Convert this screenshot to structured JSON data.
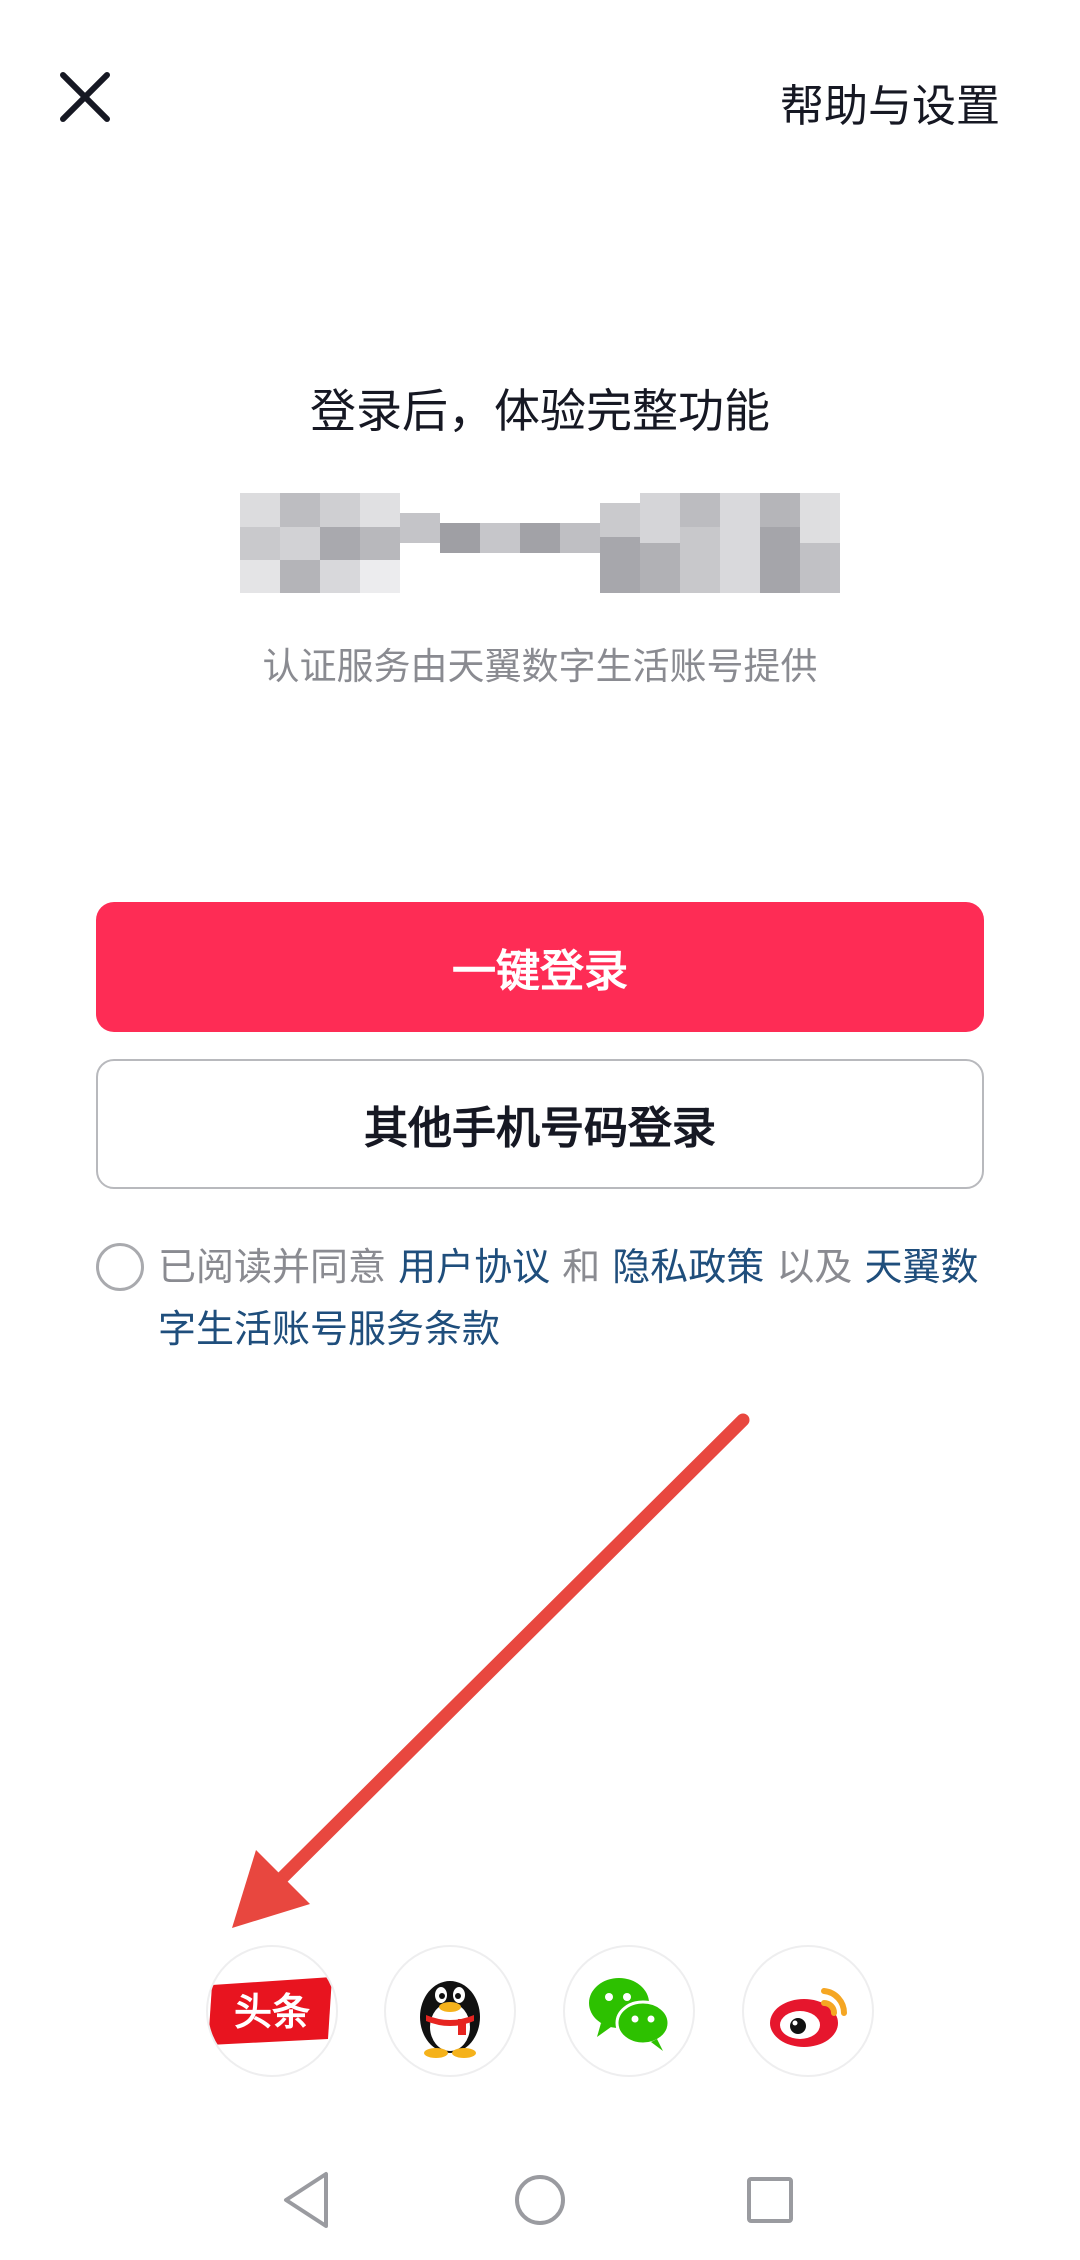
{
  "header": {
    "close_icon": "close-icon",
    "help_settings_label": "帮助与设置"
  },
  "login": {
    "title": "登录后，体验完整功能",
    "provider_note": "认证服务由天翼数字生活账号提供",
    "one_click_label": "一键登录",
    "other_phone_label": "其他手机号码登录"
  },
  "agreement": {
    "prefix": "已阅读并同意 ",
    "user_agreement": "用户协议",
    "and": " 和 ",
    "privacy_policy": "隐私政策",
    "and_also": " 以及 ",
    "telecom_terms": "天翼数字生活账号服务条款"
  },
  "social_logins": [
    {
      "name": "toutiao",
      "label": "头条",
      "icon": "toutiao-icon"
    },
    {
      "name": "qq",
      "icon": "qq-penguin-icon"
    },
    {
      "name": "wechat",
      "icon": "wechat-icon"
    },
    {
      "name": "weibo",
      "icon": "weibo-icon"
    }
  ],
  "nav": {
    "back_icon": "back-triangle-icon",
    "home_icon": "home-circle-icon",
    "recent_icon": "recent-square-icon"
  },
  "colors": {
    "primary": "#fe2c55",
    "link": "#1f4e7c",
    "annotation_arrow": "#e8473f"
  }
}
